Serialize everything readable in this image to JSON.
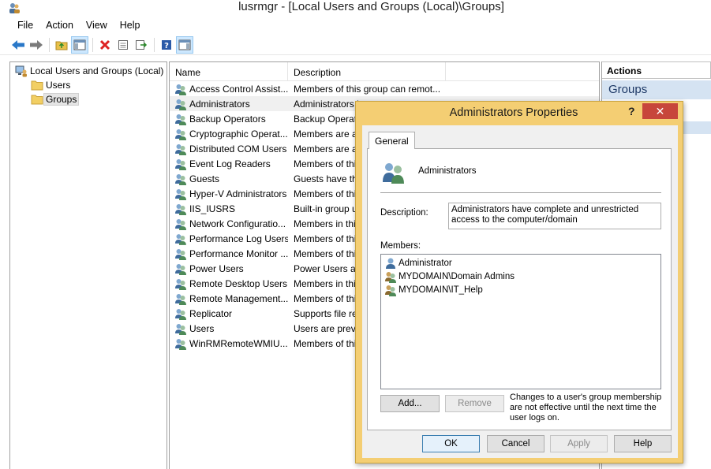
{
  "window": {
    "title": "lusrmgr - [Local Users and Groups (Local)\\Groups]"
  },
  "menu": [
    "File",
    "Action",
    "View",
    "Help"
  ],
  "toolbar": {
    "icons": [
      "back-arrow-icon",
      "forward-arrow-icon",
      "up-folder-icon",
      "show-hide-tree-icon",
      "delete-icon",
      "properties-icon",
      "export-list-icon",
      "help-icon",
      "show-hide-action-pane-icon"
    ]
  },
  "tree": {
    "root": "Local Users and Groups (Local)",
    "children": [
      "Users",
      "Groups"
    ],
    "selected": "Groups"
  },
  "list": {
    "columns": [
      "Name",
      "Description"
    ],
    "rows": [
      {
        "name": "Access Control Assist...",
        "desc": "Members of this group can remot..."
      },
      {
        "name": "Administrators",
        "desc": "Administrators have com"
      },
      {
        "name": "Backup Operators",
        "desc": "Backup Operators can"
      },
      {
        "name": "Cryptographic Operat...",
        "desc": "Members are au"
      },
      {
        "name": "Distributed COM Users",
        "desc": "Members are al"
      },
      {
        "name": "Event Log Readers",
        "desc": "Members of thi"
      },
      {
        "name": "Guests",
        "desc": "Guests have the"
      },
      {
        "name": "Hyper-V Administrators",
        "desc": "Members of thi"
      },
      {
        "name": "IIS_IUSRS",
        "desc": "Built-in group u"
      },
      {
        "name": "Network Configuratio...",
        "desc": "Members in thi"
      },
      {
        "name": "Performance Log Users",
        "desc": "Members of thi"
      },
      {
        "name": "Performance Monitor ...",
        "desc": "Members of thi"
      },
      {
        "name": "Power Users",
        "desc": "Power Users are"
      },
      {
        "name": "Remote Desktop Users",
        "desc": "Members in thi"
      },
      {
        "name": "Remote Management...",
        "desc": "Members of thi"
      },
      {
        "name": "Replicator",
        "desc": "Supports file re"
      },
      {
        "name": "Users",
        "desc": "Users are preve"
      },
      {
        "name": "WinRMRemoteWMIU...",
        "desc": "Members of thi"
      }
    ]
  },
  "actions": {
    "header": "Actions",
    "section": "Groups"
  },
  "dialog": {
    "title": "Administrators Properties",
    "help_glyph": "?",
    "close_glyph": "✕",
    "tab": "General",
    "group_name": "Administrators",
    "description_label": "Description:",
    "description": "Administrators have complete and unrestricted access to the computer/domain",
    "members_label": "Members:",
    "members": [
      "Administrator",
      "MYDOMAIN\\Domain Admins",
      "MYDOMAIN\\IT_Help"
    ],
    "add_button": "Add...",
    "remove_button": "Remove",
    "note": "Changes to a user's group membership are not effective until the next time the user logs on.",
    "ok_button": "OK",
    "cancel_button": "Cancel",
    "apply_button": "Apply",
    "help_button": "Help"
  },
  "colors": {
    "dialog_frame": "#f4ce73",
    "close_button": "#c7463b",
    "actions_section": "#d5e3f2",
    "selection": "#cde8ff"
  }
}
